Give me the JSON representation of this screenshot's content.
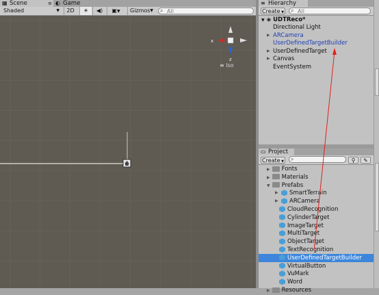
{
  "scene_tabs": [
    {
      "label": "Scene",
      "icon": "scene-icon"
    },
    {
      "label": "Game",
      "icon": "game-icon"
    }
  ],
  "scene_toolbar": {
    "shading": "Shaded",
    "mode_2d": "2D",
    "sun_icon": "☀",
    "audio_icon": "◀)",
    "fx_icon": "▣",
    "gizmos": "Gizmos",
    "search_placeholder": "All"
  },
  "gizmo": {
    "z_label": "z",
    "x_label": "x",
    "projection": "Iso"
  },
  "hierarchy": {
    "tab_label": "Hierarchy",
    "create_label": "Create",
    "search_placeholder": "All",
    "scene_name": "UDTReco*",
    "items": [
      {
        "label": "Directional Light",
        "expandable": false,
        "color": "normal"
      },
      {
        "label": "ARCamera",
        "expandable": true,
        "color": "blue"
      },
      {
        "label": "UserDefinedTargetBuilder",
        "expandable": false,
        "color": "blue"
      },
      {
        "label": "UserDefinedTarget",
        "expandable": true,
        "color": "normal"
      },
      {
        "label": "Canvas",
        "expandable": true,
        "color": "normal"
      },
      {
        "label": "EventSystem",
        "expandable": false,
        "color": "normal"
      }
    ]
  },
  "project": {
    "tab_label": "Project",
    "create_label": "Create",
    "folders": [
      {
        "label": "Fonts",
        "expanded": false
      },
      {
        "label": "Materials",
        "expanded": false
      },
      {
        "label": "Prefabs",
        "expanded": true
      }
    ],
    "prefabs": [
      {
        "label": "SmartTerrain",
        "expandable": true,
        "selected": false
      },
      {
        "label": "ARCamera",
        "expandable": true,
        "selected": false
      },
      {
        "label": "CloudRecognition",
        "expandable": false,
        "selected": false
      },
      {
        "label": "CylinderTarget",
        "expandable": false,
        "selected": false
      },
      {
        "label": "ImageTarget",
        "expandable": false,
        "selected": false
      },
      {
        "label": "MultiTarget",
        "expandable": false,
        "selected": false
      },
      {
        "label": "ObjectTarget",
        "expandable": false,
        "selected": false
      },
      {
        "label": "TextRecognition",
        "expandable": false,
        "selected": false
      },
      {
        "label": "UserDefinedTargetBuilder",
        "expandable": false,
        "selected": true
      },
      {
        "label": "VirtualButton",
        "expandable": false,
        "selected": false
      },
      {
        "label": "VuMark",
        "expandable": false,
        "selected": false
      },
      {
        "label": "Word",
        "expandable": false,
        "selected": false
      }
    ],
    "partial_row": "Resources"
  },
  "colors": {
    "annotation_arrow": "#e0201a",
    "selection": "#3d86db",
    "link_blue": "#2040b4"
  }
}
